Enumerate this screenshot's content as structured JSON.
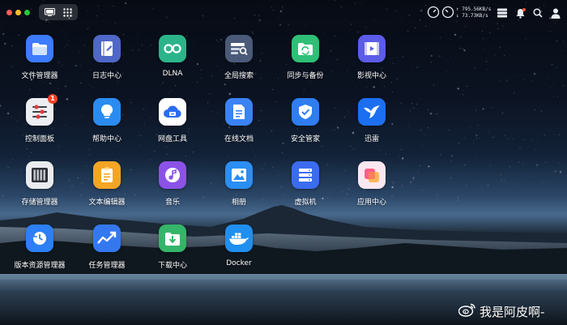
{
  "topbar": {
    "upload_rate": "↑ 795.56KB/s",
    "download_rate": "↓ 73.73KB/s",
    "notification_dot": true
  },
  "apps": [
    {
      "label": "文件管理器",
      "icon": "folder-icon",
      "color": "#3d7bff"
    },
    {
      "label": "日志中心",
      "icon": "log-book-icon",
      "color": "#4f67c7"
    },
    {
      "label": "DLNA",
      "icon": "dlna-icon",
      "color": "#2bb48a"
    },
    {
      "label": "全局搜索",
      "icon": "global-search-icon",
      "color": "#4a5a78"
    },
    {
      "label": "同步与备份",
      "icon": "sync-backup-icon",
      "color": "#2fbf76"
    },
    {
      "label": "影视中心",
      "icon": "video-icon",
      "color": "#5b5ce8"
    },
    {
      "label": "控制面板",
      "icon": "control-panel-icon",
      "color": "#eceef2",
      "badge": "1"
    },
    {
      "label": "帮助中心",
      "icon": "help-bulb-icon",
      "color": "#2a8cf0"
    },
    {
      "label": "网盘工具",
      "icon": "cloud-drive-icon",
      "color": "#ffffff"
    },
    {
      "label": "在线文档",
      "icon": "online-doc-icon",
      "color": "#3a82f6"
    },
    {
      "label": "安全管家",
      "icon": "security-shield-icon",
      "color": "#2f7df0"
    },
    {
      "label": "迅雷",
      "icon": "thunder-bird-icon",
      "color": "#1d6ff2"
    },
    {
      "label": "存储管理器",
      "icon": "storage-icon",
      "color": "#e9ebef"
    },
    {
      "label": "文本编辑器",
      "icon": "text-editor-icon",
      "color": "#f5a524"
    },
    {
      "label": "音乐",
      "icon": "music-icon",
      "color": "#8b52e8"
    },
    {
      "label": "相册",
      "icon": "photo-album-icon",
      "color": "#2a8ef3"
    },
    {
      "label": "虚拟机",
      "icon": "virtual-machine-icon",
      "color": "#3b6cf0"
    },
    {
      "label": "应用中心",
      "icon": "app-center-icon",
      "color": "#fbe7ef"
    },
    {
      "label": "版本资源管理器",
      "icon": "version-explorer-icon",
      "color": "#2d7ff5"
    },
    {
      "label": "任务管理器",
      "icon": "task-manager-icon",
      "color": "#3478f0"
    },
    {
      "label": "下载中心",
      "icon": "download-center-icon",
      "color": "#35b56a"
    },
    {
      "label": "Docker",
      "icon": "docker-icon",
      "color": "#1f8ff0"
    }
  ],
  "watermark": {
    "text": "我是阿皮啊-",
    "icon": "weibo-icon"
  }
}
